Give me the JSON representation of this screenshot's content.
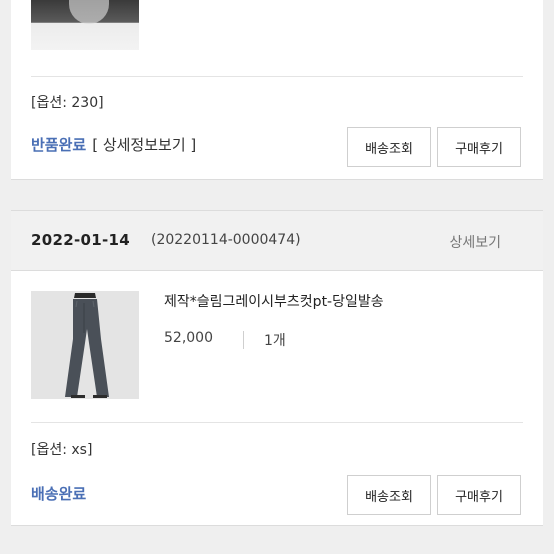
{
  "orders": [
    {
      "option": "[옵션: 230]",
      "status": "반품완료",
      "detail_link": "[ 상세정보보기 ]",
      "buttons": {
        "shipping": "배송조회",
        "review": "구매후기"
      }
    },
    {
      "date": "2022-01-14",
      "order_number": "(20220114-0000474)",
      "view_detail": "상세보기",
      "product_name": "제작*슬림그레이시부츠컷pt-당일발송",
      "price": "52,000",
      "quantity": "1개",
      "option": "[옵션: xs]",
      "status": "배송완료",
      "buttons": {
        "shipping": "배송조회",
        "review": "구매후기"
      }
    }
  ],
  "colors": {
    "status_blue": "#4a6fb5",
    "background": "#efefef"
  }
}
